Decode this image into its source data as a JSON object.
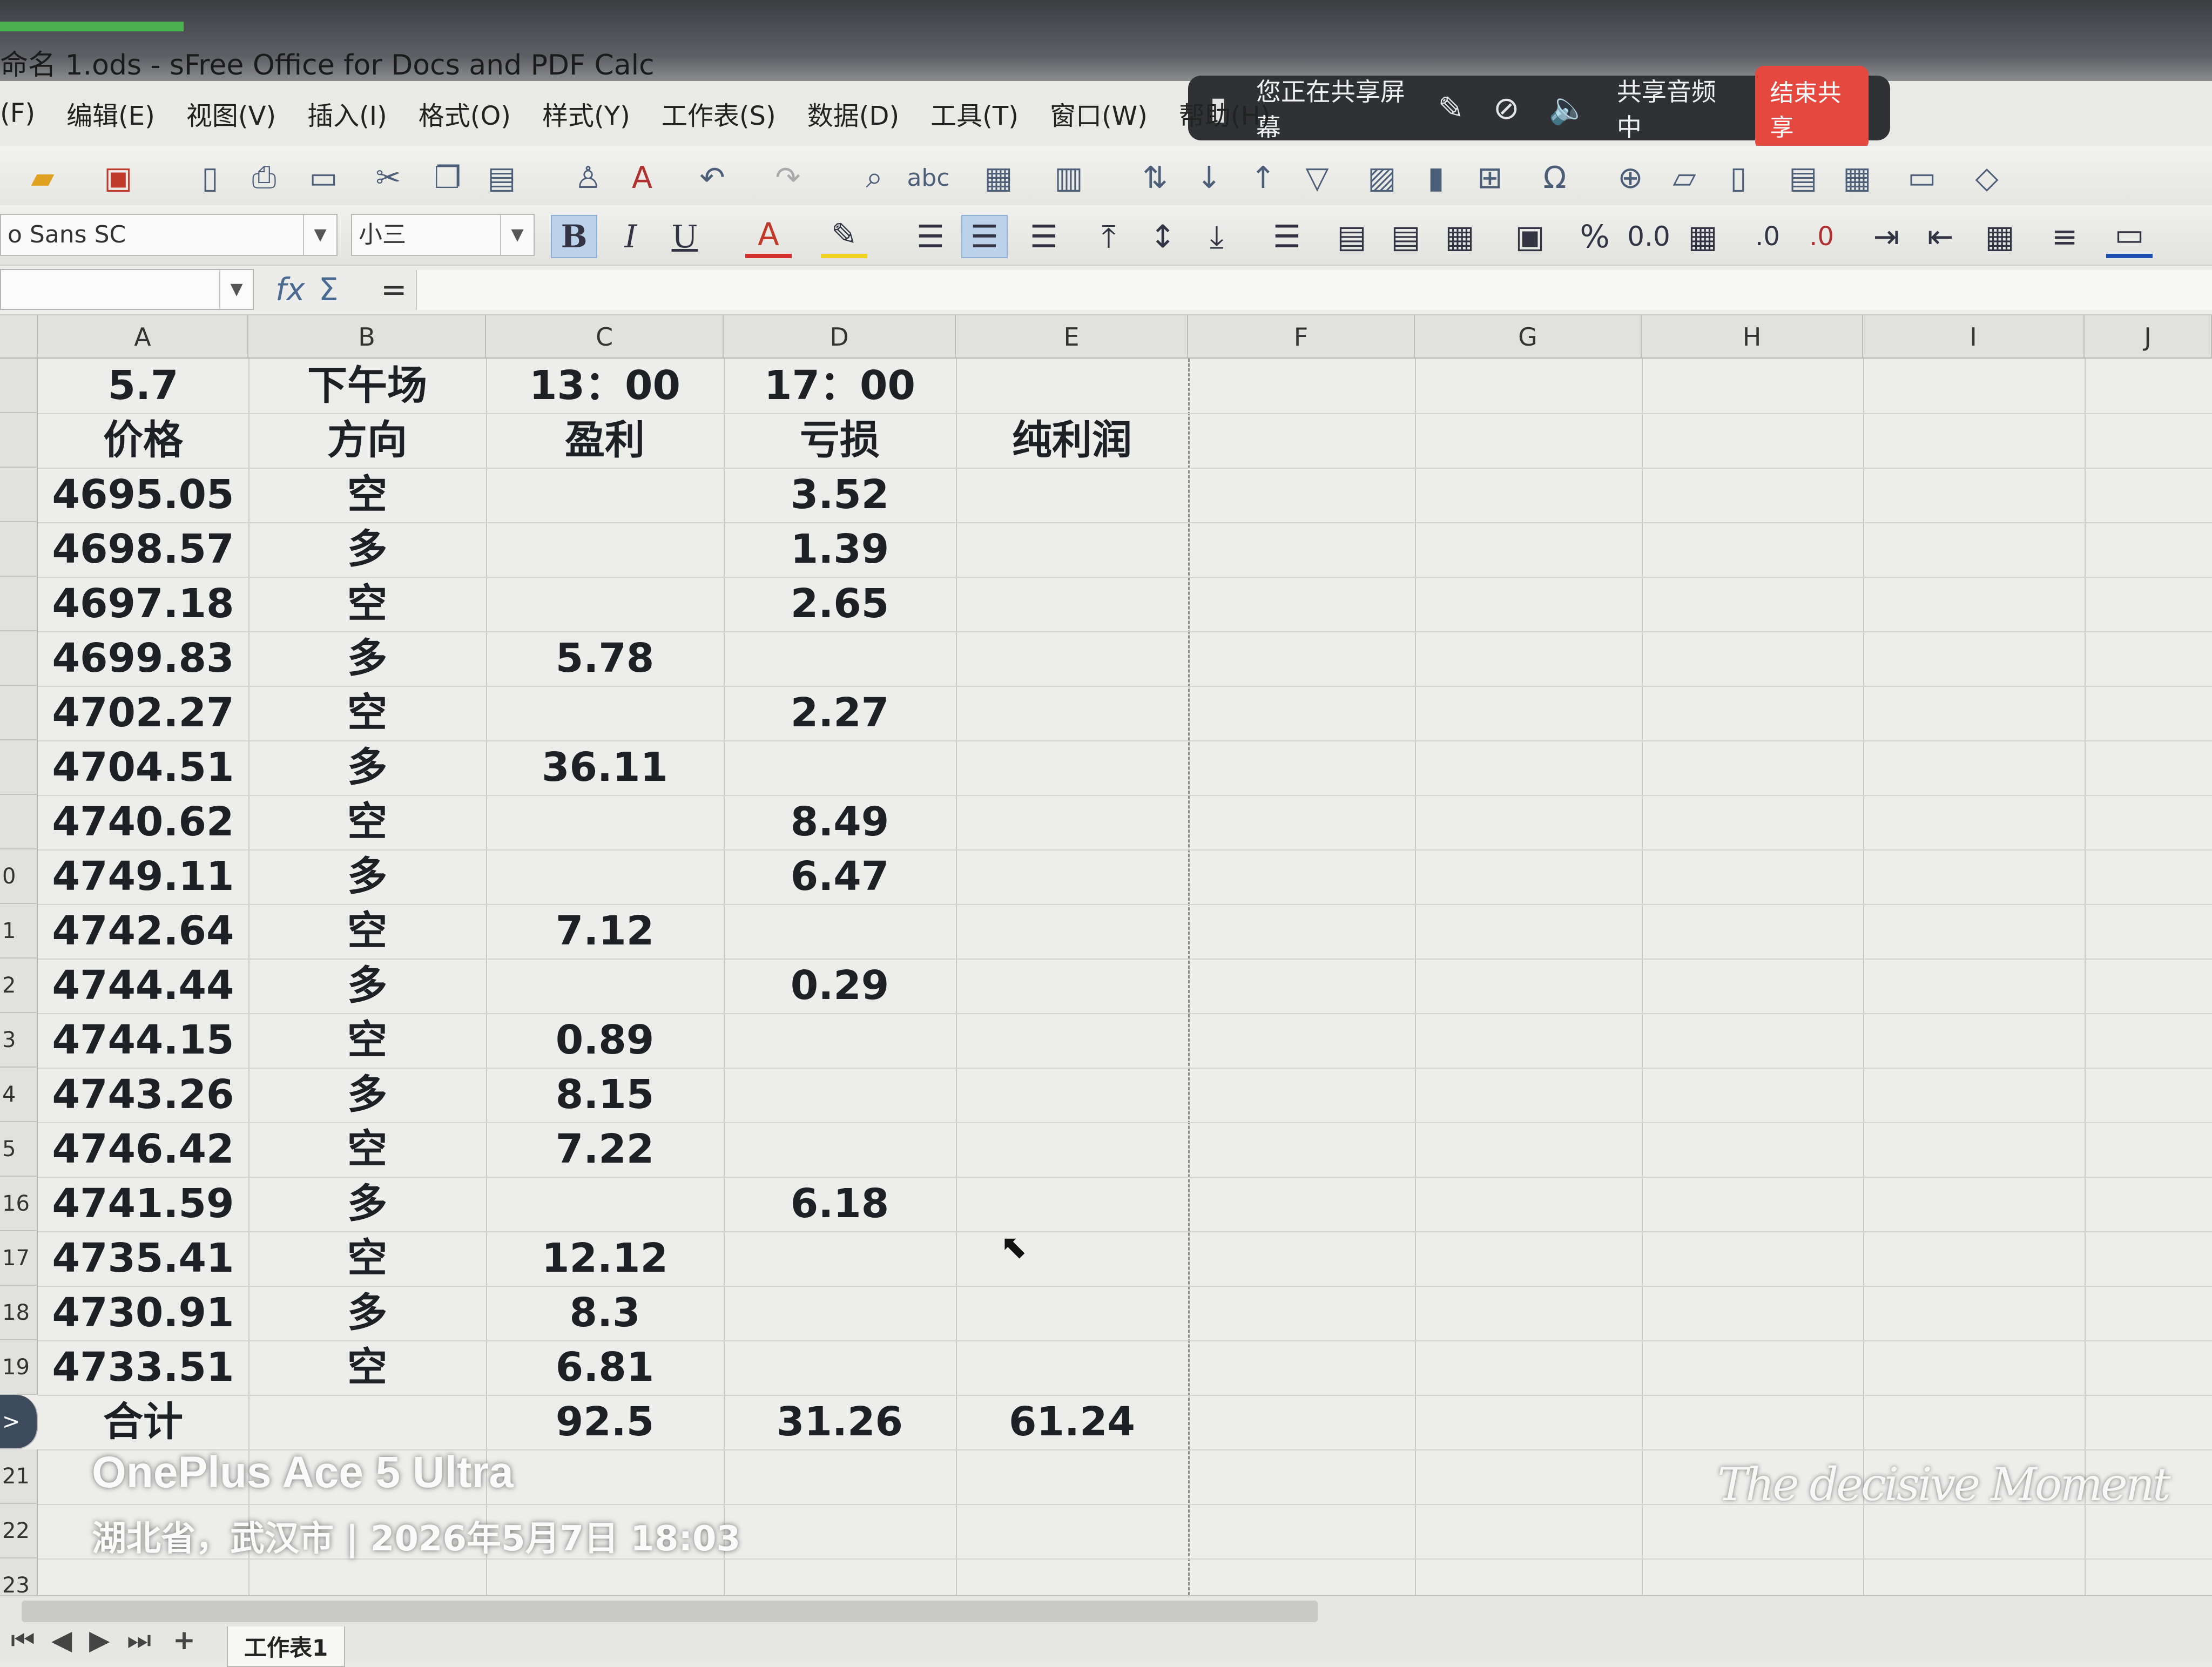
{
  "window": {
    "title": "命名 1.ods - sFree Office for Docs and PDF Calc"
  },
  "share_bar": {
    "status": "您正在共享屏幕",
    "audio": "共享音频中",
    "stop_label": "结束共享"
  },
  "menu": [
    "(F)",
    "编辑(E)",
    "视图(V)",
    "插入(I)",
    "格式(O)",
    "样式(Y)",
    "工作表(S)",
    "数据(D)",
    "工具(T)",
    "窗口(W)",
    "帮助(H)"
  ],
  "formatting": {
    "font_name": "o Sans SC",
    "font_size": "小三",
    "bold": "B",
    "italic": "I",
    "underline": "U",
    "font_color": "A",
    "percent": "%",
    "number": "0.0"
  },
  "formula_bar": {
    "fx": "fx",
    "sum": "Σ",
    "equals": "="
  },
  "columns": [
    "A",
    "B",
    "C",
    "D",
    "E",
    "F",
    "G",
    "H",
    "I",
    "J"
  ],
  "row_numbers": [
    "",
    "",
    "",
    "",
    "",
    "",
    "",
    "",
    "",
    "0",
    "1",
    "2",
    "3",
    "4",
    "5",
    "16",
    "17",
    "18",
    "19",
    ">",
    "21",
    "22",
    "23"
  ],
  "sheet": {
    "header1": [
      "5.7",
      "下午场",
      "13：00",
      "17：00",
      ""
    ],
    "header2": [
      "价格",
      "方向",
      "盈利",
      "亏损",
      "纯利润"
    ],
    "rows": [
      [
        "4695.05",
        "空",
        "",
        "3.52",
        ""
      ],
      [
        "4698.57",
        "多",
        "",
        "1.39",
        ""
      ],
      [
        "4697.18",
        "空",
        "",
        "2.65",
        ""
      ],
      [
        "4699.83",
        "多",
        "5.78",
        "",
        ""
      ],
      [
        "4702.27",
        "空",
        "",
        "2.27",
        ""
      ],
      [
        "4704.51",
        "多",
        "36.11",
        "",
        ""
      ],
      [
        "4740.62",
        "空",
        "",
        "8.49",
        ""
      ],
      [
        "4749.11",
        "多",
        "",
        "6.47",
        ""
      ],
      [
        "4742.64",
        "空",
        "7.12",
        "",
        ""
      ],
      [
        "4744.44",
        "多",
        "",
        "0.29",
        ""
      ],
      [
        "4744.15",
        "空",
        "0.89",
        "",
        ""
      ],
      [
        "4743.26",
        "多",
        "8.15",
        "",
        ""
      ],
      [
        "4746.42",
        "空",
        "7.22",
        "",
        ""
      ],
      [
        "4741.59",
        "多",
        "",
        "6.18",
        ""
      ],
      [
        "4735.41",
        "空",
        "12.12",
        "",
        ""
      ],
      [
        "4730.91",
        "多",
        "8.3",
        "",
        ""
      ],
      [
        "4733.51",
        "空",
        "6.81",
        "",
        ""
      ]
    ],
    "total": [
      "合计",
      "",
      "92.5",
      "31.26",
      "61.24"
    ]
  },
  "tabs": {
    "add": "+",
    "sheet1": "工作表1"
  },
  "watermark": {
    "model": "OnePlus Ace 5 Ultra",
    "location_time": "湖北省，武汉市 | 2026年5月7日 18:03"
  }
}
